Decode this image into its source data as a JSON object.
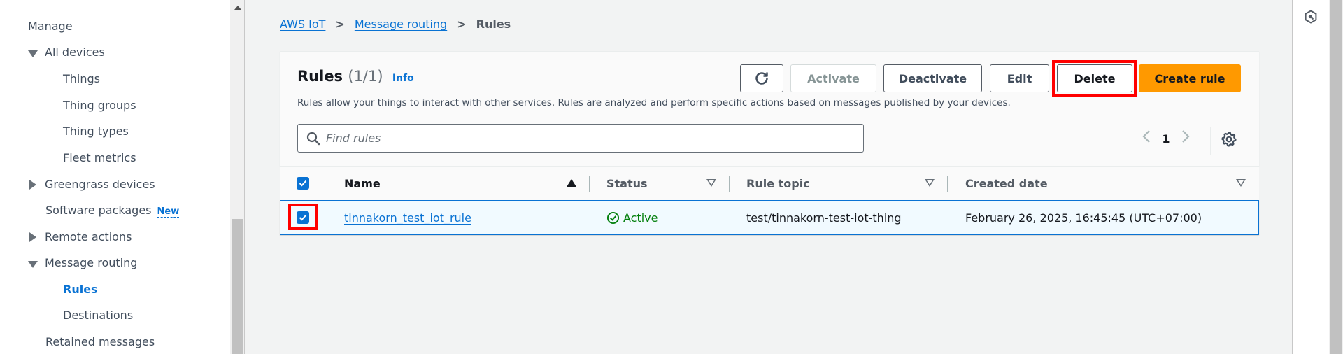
{
  "sidebar": {
    "section_label": "Manage",
    "items": [
      {
        "label": "All devices",
        "expander": "caret-down"
      },
      {
        "label": "Things"
      },
      {
        "label": "Thing groups"
      },
      {
        "label": "Thing types"
      },
      {
        "label": "Fleet metrics"
      },
      {
        "label": "Greengrass devices",
        "expander": "caret-right"
      },
      {
        "label": "Software packages",
        "badge": "New"
      },
      {
        "label": "Remote actions",
        "expander": "caret-right"
      },
      {
        "label": "Message routing",
        "expander": "caret-down"
      },
      {
        "label": "Rules",
        "active": true
      },
      {
        "label": "Destinations"
      },
      {
        "label": "Retained messages"
      }
    ]
  },
  "breadcrumb": {
    "items": [
      "AWS IoT",
      "Message routing"
    ],
    "current": "Rules",
    "separator": ">"
  },
  "panel": {
    "title": "Rules",
    "count": "(1/1)",
    "info_label": "Info",
    "description": "Rules allow your things to interact with other services. Rules are analyzed and perform specific actions based on messages published by your devices.",
    "buttons": {
      "refresh_icon": "refresh-icon",
      "activate": "Activate",
      "deactivate": "Deactivate",
      "edit": "Edit",
      "delete": "Delete",
      "create": "Create rule"
    },
    "search": {
      "placeholder": "Find rules",
      "value": ""
    },
    "pagination": {
      "current_page": "1",
      "prev_icon": "chevron-left-icon",
      "next_icon": "chevron-right-icon"
    },
    "settings_icon": "gear-icon"
  },
  "table": {
    "columns": [
      "Name",
      "Status",
      "Rule topic",
      "Created date"
    ],
    "sort": {
      "column": "Name",
      "direction": "ascending"
    },
    "select_all_checked": true,
    "rows": [
      {
        "selected": true,
        "name": "tinnakorn_test_iot_rule",
        "status": "Active",
        "rule_topic": "test/tinnakorn-test-iot-thing",
        "created_date": "February 26, 2025, 16:45:45 (UTC+07:00)"
      }
    ]
  },
  "colors": {
    "accent": "#0972d3",
    "primary_button": "#ff9900",
    "status_active": "#037f0c",
    "highlight": "#ff0000",
    "selected_row": "#f1faff"
  },
  "right_panel": {
    "icon": "cloudshell-hex-icon"
  }
}
